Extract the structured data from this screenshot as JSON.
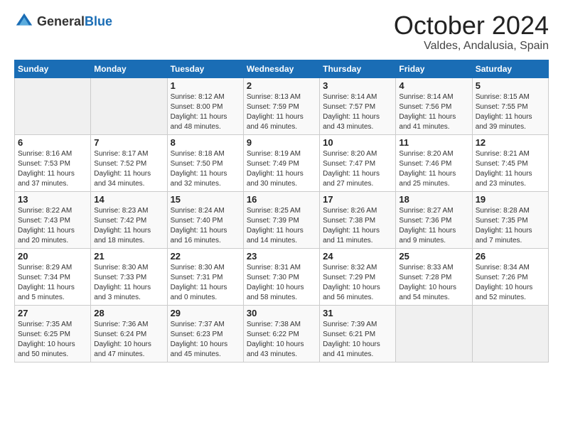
{
  "header": {
    "logo_general": "General",
    "logo_blue": "Blue",
    "month": "October 2024",
    "location": "Valdes, Andalusia, Spain"
  },
  "days_of_week": [
    "Sunday",
    "Monday",
    "Tuesday",
    "Wednesday",
    "Thursday",
    "Friday",
    "Saturday"
  ],
  "weeks": [
    [
      {
        "day": "",
        "sunrise": "",
        "sunset": "",
        "daylight": ""
      },
      {
        "day": "",
        "sunrise": "",
        "sunset": "",
        "daylight": ""
      },
      {
        "day": "1",
        "sunrise": "Sunrise: 8:12 AM",
        "sunset": "Sunset: 8:00 PM",
        "daylight": "Daylight: 11 hours and 48 minutes."
      },
      {
        "day": "2",
        "sunrise": "Sunrise: 8:13 AM",
        "sunset": "Sunset: 7:59 PM",
        "daylight": "Daylight: 11 hours and 46 minutes."
      },
      {
        "day": "3",
        "sunrise": "Sunrise: 8:14 AM",
        "sunset": "Sunset: 7:57 PM",
        "daylight": "Daylight: 11 hours and 43 minutes."
      },
      {
        "day": "4",
        "sunrise": "Sunrise: 8:14 AM",
        "sunset": "Sunset: 7:56 PM",
        "daylight": "Daylight: 11 hours and 41 minutes."
      },
      {
        "day": "5",
        "sunrise": "Sunrise: 8:15 AM",
        "sunset": "Sunset: 7:55 PM",
        "daylight": "Daylight: 11 hours and 39 minutes."
      }
    ],
    [
      {
        "day": "6",
        "sunrise": "Sunrise: 8:16 AM",
        "sunset": "Sunset: 7:53 PM",
        "daylight": "Daylight: 11 hours and 37 minutes."
      },
      {
        "day": "7",
        "sunrise": "Sunrise: 8:17 AM",
        "sunset": "Sunset: 7:52 PM",
        "daylight": "Daylight: 11 hours and 34 minutes."
      },
      {
        "day": "8",
        "sunrise": "Sunrise: 8:18 AM",
        "sunset": "Sunset: 7:50 PM",
        "daylight": "Daylight: 11 hours and 32 minutes."
      },
      {
        "day": "9",
        "sunrise": "Sunrise: 8:19 AM",
        "sunset": "Sunset: 7:49 PM",
        "daylight": "Daylight: 11 hours and 30 minutes."
      },
      {
        "day": "10",
        "sunrise": "Sunrise: 8:20 AM",
        "sunset": "Sunset: 7:47 PM",
        "daylight": "Daylight: 11 hours and 27 minutes."
      },
      {
        "day": "11",
        "sunrise": "Sunrise: 8:20 AM",
        "sunset": "Sunset: 7:46 PM",
        "daylight": "Daylight: 11 hours and 25 minutes."
      },
      {
        "day": "12",
        "sunrise": "Sunrise: 8:21 AM",
        "sunset": "Sunset: 7:45 PM",
        "daylight": "Daylight: 11 hours and 23 minutes."
      }
    ],
    [
      {
        "day": "13",
        "sunrise": "Sunrise: 8:22 AM",
        "sunset": "Sunset: 7:43 PM",
        "daylight": "Daylight: 11 hours and 20 minutes."
      },
      {
        "day": "14",
        "sunrise": "Sunrise: 8:23 AM",
        "sunset": "Sunset: 7:42 PM",
        "daylight": "Daylight: 11 hours and 18 minutes."
      },
      {
        "day": "15",
        "sunrise": "Sunrise: 8:24 AM",
        "sunset": "Sunset: 7:40 PM",
        "daylight": "Daylight: 11 hours and 16 minutes."
      },
      {
        "day": "16",
        "sunrise": "Sunrise: 8:25 AM",
        "sunset": "Sunset: 7:39 PM",
        "daylight": "Daylight: 11 hours and 14 minutes."
      },
      {
        "day": "17",
        "sunrise": "Sunrise: 8:26 AM",
        "sunset": "Sunset: 7:38 PM",
        "daylight": "Daylight: 11 hours and 11 minutes."
      },
      {
        "day": "18",
        "sunrise": "Sunrise: 8:27 AM",
        "sunset": "Sunset: 7:36 PM",
        "daylight": "Daylight: 11 hours and 9 minutes."
      },
      {
        "day": "19",
        "sunrise": "Sunrise: 8:28 AM",
        "sunset": "Sunset: 7:35 PM",
        "daylight": "Daylight: 11 hours and 7 minutes."
      }
    ],
    [
      {
        "day": "20",
        "sunrise": "Sunrise: 8:29 AM",
        "sunset": "Sunset: 7:34 PM",
        "daylight": "Daylight: 11 hours and 5 minutes."
      },
      {
        "day": "21",
        "sunrise": "Sunrise: 8:30 AM",
        "sunset": "Sunset: 7:33 PM",
        "daylight": "Daylight: 11 hours and 3 minutes."
      },
      {
        "day": "22",
        "sunrise": "Sunrise: 8:30 AM",
        "sunset": "Sunset: 7:31 PM",
        "daylight": "Daylight: 11 hours and 0 minutes."
      },
      {
        "day": "23",
        "sunrise": "Sunrise: 8:31 AM",
        "sunset": "Sunset: 7:30 PM",
        "daylight": "Daylight: 10 hours and 58 minutes."
      },
      {
        "day": "24",
        "sunrise": "Sunrise: 8:32 AM",
        "sunset": "Sunset: 7:29 PM",
        "daylight": "Daylight: 10 hours and 56 minutes."
      },
      {
        "day": "25",
        "sunrise": "Sunrise: 8:33 AM",
        "sunset": "Sunset: 7:28 PM",
        "daylight": "Daylight: 10 hours and 54 minutes."
      },
      {
        "day": "26",
        "sunrise": "Sunrise: 8:34 AM",
        "sunset": "Sunset: 7:26 PM",
        "daylight": "Daylight: 10 hours and 52 minutes."
      }
    ],
    [
      {
        "day": "27",
        "sunrise": "Sunrise: 7:35 AM",
        "sunset": "Sunset: 6:25 PM",
        "daylight": "Daylight: 10 hours and 50 minutes."
      },
      {
        "day": "28",
        "sunrise": "Sunrise: 7:36 AM",
        "sunset": "Sunset: 6:24 PM",
        "daylight": "Daylight: 10 hours and 47 minutes."
      },
      {
        "day": "29",
        "sunrise": "Sunrise: 7:37 AM",
        "sunset": "Sunset: 6:23 PM",
        "daylight": "Daylight: 10 hours and 45 minutes."
      },
      {
        "day": "30",
        "sunrise": "Sunrise: 7:38 AM",
        "sunset": "Sunset: 6:22 PM",
        "daylight": "Daylight: 10 hours and 43 minutes."
      },
      {
        "day": "31",
        "sunrise": "Sunrise: 7:39 AM",
        "sunset": "Sunset: 6:21 PM",
        "daylight": "Daylight: 10 hours and 41 minutes."
      },
      {
        "day": "",
        "sunrise": "",
        "sunset": "",
        "daylight": ""
      },
      {
        "day": "",
        "sunrise": "",
        "sunset": "",
        "daylight": ""
      }
    ]
  ]
}
